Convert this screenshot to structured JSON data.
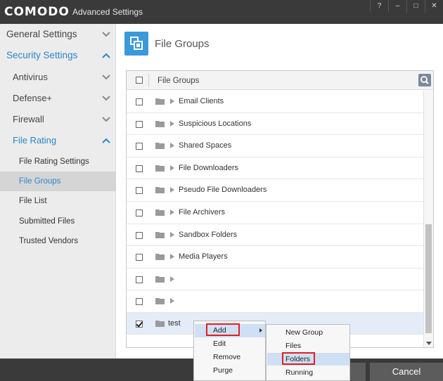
{
  "window": {
    "brand": "COMODO",
    "title": "Advanced Settings",
    "controls": [
      "?",
      "–",
      "□",
      "✕"
    ]
  },
  "sidebar": {
    "sections": [
      {
        "label": "General Settings",
        "expanded": false
      },
      {
        "label": "Security Settings",
        "expanded": true
      }
    ],
    "security_items": [
      {
        "label": "Antivirus"
      },
      {
        "label": "Defense+"
      },
      {
        "label": "Firewall"
      },
      {
        "label": "File Rating"
      }
    ],
    "file_rating_items": [
      {
        "label": "File Rating Settings"
      },
      {
        "label": "File Groups",
        "selected": true
      },
      {
        "label": "File List"
      },
      {
        "label": "Submitted Files"
      },
      {
        "label": "Trusted Vendors"
      }
    ]
  },
  "main": {
    "title": "File Groups",
    "list_header": "File Groups",
    "rows": [
      {
        "label": "Email Clients",
        "checked": false
      },
      {
        "label": "Suspicious Locations",
        "checked": false
      },
      {
        "label": "Shared Spaces",
        "checked": false
      },
      {
        "label": "File Downloaders",
        "checked": false
      },
      {
        "label": "Pseudo File Downloaders",
        "checked": false
      },
      {
        "label": "File Archivers",
        "checked": false
      },
      {
        "label": "Sandbox Folders",
        "checked": false
      },
      {
        "label": "Media Players",
        "checked": false
      },
      {
        "label": "",
        "checked": false
      },
      {
        "label": "",
        "checked": false
      },
      {
        "label": "test",
        "checked": true
      }
    ]
  },
  "context_menu": {
    "items": [
      "Add",
      "Edit",
      "Remove",
      "Purge"
    ],
    "highlighted": "Add"
  },
  "submenu": {
    "items": [
      "New Group",
      "Files",
      "Folders",
      "Running Processes"
    ],
    "highlighted": "Folders"
  },
  "footer": {
    "cancel_label": "Cancel"
  },
  "colors": {
    "accent": "#2b87c9",
    "titlebar": "#3a3a3a",
    "highlight": "#e02020"
  }
}
